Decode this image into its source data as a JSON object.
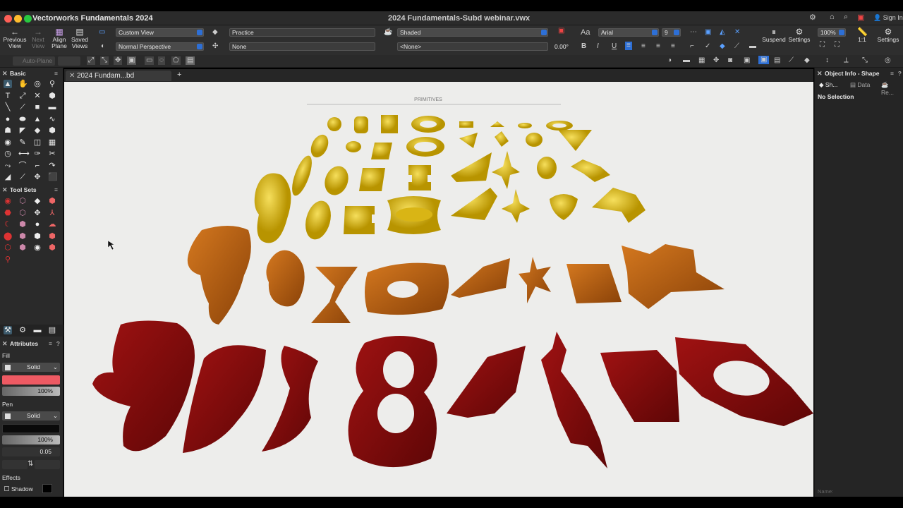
{
  "window": {
    "app_title": "Vectorworks Fundamentals 2024",
    "doc_title": "2024 Fundamentals-Subd webinar.vwx",
    "sign_in": "Sign In"
  },
  "toolbar": {
    "previous_view": "Previous View",
    "next_view": "Next View",
    "align_plane": "Align Plane",
    "saved_views": "Saved Views",
    "view_value": "Custom View",
    "projection_value": "Normal Perspective",
    "class_value": "Practice",
    "layer_value": "None",
    "render_value": "Shaded",
    "lighting_value": "<None>",
    "angle_value": "0.00°",
    "font_name": "Arial",
    "font_size": "9",
    "suspend": "Suspend",
    "settings": "Settings",
    "zoom": "100%",
    "ratio": "1:1",
    "settings2": "Settings",
    "auto_plane": "Auto-Plane"
  },
  "tab": {
    "label": "2024 Fundam...bd webinar.vwx",
    "add": "+"
  },
  "left_panel": {
    "basic_title": "Basic",
    "toolsets_title": "Tool Sets",
    "attributes_title": "Attributes",
    "fill_label": "Fill",
    "fill_style": "Solid",
    "fill_color": "#ee5a63",
    "fill_opacity": "100%",
    "pen_label": "Pen",
    "pen_style": "Solid",
    "pen_color": "#0a0a0a",
    "pen_opacity": "100%",
    "pen_weight": "0.05",
    "effects_label": "Effects",
    "shadow_label": "Shadow"
  },
  "right_panel": {
    "title": "Object Info - Shape",
    "tab_shape": "Sh...",
    "tab_data": "Data",
    "tab_render": "Re...",
    "no_selection": "No Selection",
    "name_label": "Name:"
  },
  "canvas": {
    "heading": "PRIMITIVES",
    "colors": {
      "yellow": "#e3c21c",
      "orange": "#bb5f0f",
      "red": "#8c0c0c",
      "paper": "#ededeb"
    }
  }
}
